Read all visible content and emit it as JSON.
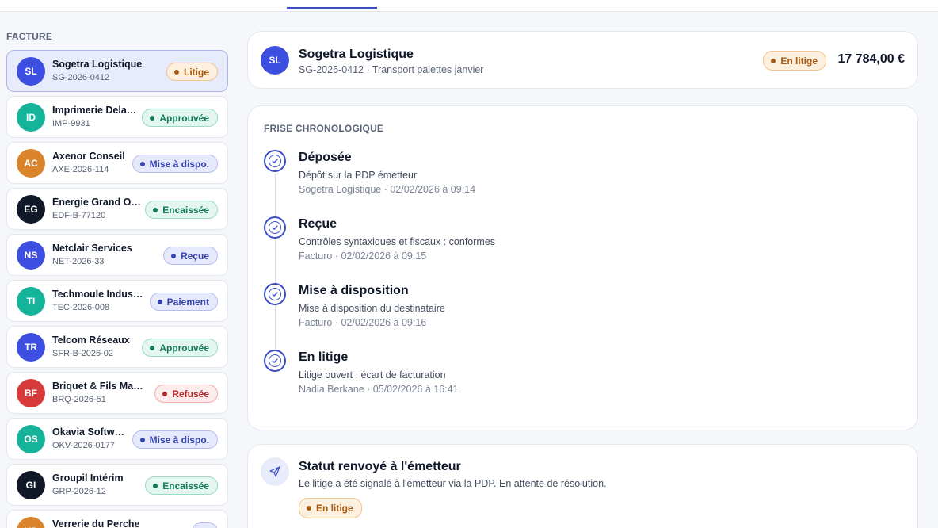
{
  "sidebar": {
    "title": "FACTURE",
    "items": [
      {
        "initials": "SL",
        "name": "Sogetra Logistique",
        "ref": "SG-2026-0412",
        "status": "Litige",
        "avatar_color": "#3d4fe0",
        "status_kind": "litige",
        "selected": true
      },
      {
        "initials": "ID",
        "name": "Imprimerie Dela…",
        "ref": "IMP-9931",
        "status": "Approuvée",
        "avatar_color": "#14b39a",
        "status_kind": "approuvee",
        "selected": false
      },
      {
        "initials": "AC",
        "name": "Axenor Conseil",
        "ref": "AXE-2026-114",
        "status": "Mise à dispo.",
        "avatar_color": "#d9832a",
        "status_kind": "dispo",
        "selected": false
      },
      {
        "initials": "EG",
        "name": "Énergie Grand O…",
        "ref": "EDF-B-77120",
        "status": "Encaissée",
        "avatar_color": "#111827",
        "status_kind": "encaissee",
        "selected": false
      },
      {
        "initials": "NS",
        "name": "Netclair Services",
        "ref": "NET-2026-33",
        "status": "Reçue",
        "avatar_color": "#3d4fe0",
        "status_kind": "recue",
        "selected": false
      },
      {
        "initials": "TI",
        "name": "Techmoule Indus…",
        "ref": "TEC-2026-008",
        "status": "Paiement",
        "avatar_color": "#14b39a",
        "status_kind": "paiement",
        "selected": false
      },
      {
        "initials": "TR",
        "name": "Telcom Réseaux",
        "ref": "SFR-B-2026-02",
        "status": "Approuvée",
        "avatar_color": "#3d4fe0",
        "status_kind": "approuvee",
        "selected": false
      },
      {
        "initials": "BF",
        "name": "Briquet & Fils Maté…",
        "ref": "BRQ-2026-51",
        "status": "Refusée",
        "avatar_color": "#d63a3a",
        "status_kind": "refusee",
        "selected": false
      },
      {
        "initials": "OS",
        "name": "Okavia Softw…",
        "ref": "OKV-2026-0177",
        "status": "Mise à dispo.",
        "avatar_color": "#14b39a",
        "status_kind": "dispo",
        "selected": false
      },
      {
        "initials": "GI",
        "name": "Groupil Intérim",
        "ref": "GRP-2026-12",
        "status": "Encaissée",
        "avatar_color": "#111827",
        "status_kind": "encaissee",
        "selected": false
      },
      {
        "initials": "VP",
        "name": "Verrerie du Perche",
        "ref": "",
        "status": "",
        "avatar_color": "#d9832a",
        "status_kind": "recue",
        "selected": false
      }
    ]
  },
  "header": {
    "initials": "SL",
    "avatar_color": "#3d4fe0",
    "name": "Sogetra Logistique",
    "subtitle": "SG-2026-0412 · Transport palettes janvier",
    "status": "En litige",
    "amount": "17 784,00 €"
  },
  "timeline": {
    "title": "FRISE CHRONOLOGIQUE",
    "steps": [
      {
        "label": "Déposée",
        "desc": "Dépôt sur la PDP émetteur",
        "meta": "Sogetra Logistique · 02/02/2026 à 09:14"
      },
      {
        "label": "Reçue",
        "desc": "Contrôles syntaxiques et fiscaux : conformes",
        "meta": "Facturo · 02/02/2026 à 09:15"
      },
      {
        "label": "Mise à disposition",
        "desc": "Mise à disposition du destinataire",
        "meta": "Facturo · 02/02/2026 à 09:16"
      },
      {
        "label": "En litige",
        "desc": "Litige ouvert : écart de facturation",
        "meta": "Nadia Berkane · 05/02/2026 à 16:41"
      }
    ]
  },
  "notice": {
    "icon": "send-icon",
    "title": "Statut renvoyé à l'émetteur",
    "desc": "Le litige a été signalé à l'émetteur via la PDP. En attente de résolution.",
    "status": "En litige"
  },
  "colors": {
    "accent": "#3b4ec4",
    "litige": "#a85a10",
    "approuvee": "#12795a",
    "dispo": "#3545b0",
    "refusee": "#b42828"
  }
}
